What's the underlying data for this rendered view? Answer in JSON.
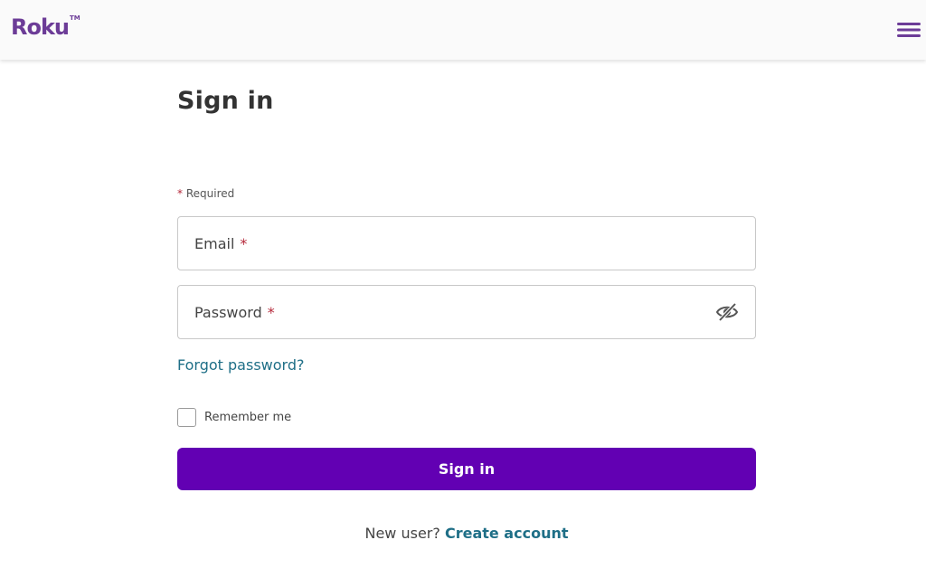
{
  "header": {
    "logo_text": "Roku",
    "logo_tm": "TM",
    "brand_color": "#6c3c97",
    "menu_icon": "hamburger-menu-icon"
  },
  "form": {
    "title": "Sign in",
    "required_star": "*",
    "required_note": "Required",
    "email_label": "Email",
    "email_value": "",
    "password_label": "Password",
    "password_value": "",
    "password_toggle_icon": "eye-slash-icon",
    "forgot_link": "Forgot password?",
    "remember_label": "Remember me",
    "remember_checked": false,
    "submit_label": "Sign in",
    "submit_color": "#6200b3"
  },
  "footer": {
    "new_user_text": "New user?",
    "create_account_link": "Create account",
    "link_color": "#1f6f87"
  }
}
